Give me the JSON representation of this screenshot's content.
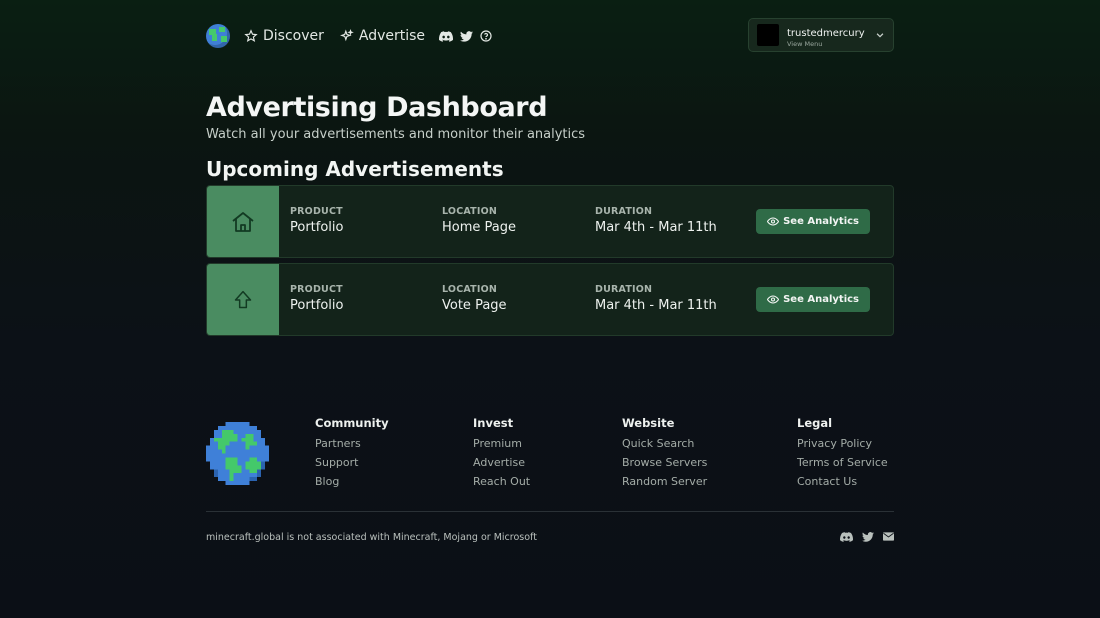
{
  "nav": {
    "discover_label": "Discover",
    "advertise_label": "Advertise",
    "socials": [
      "discord-icon",
      "twitter-icon",
      "help-icon"
    ],
    "user": {
      "name": "trustedmercury",
      "sub": "View Menu"
    }
  },
  "page": {
    "title": "Advertising Dashboard",
    "subtitle": "Watch all your advertisements and monitor their analytics",
    "section_title": "Upcoming Advertisements"
  },
  "ads": [
    {
      "icon": "home-icon",
      "product_label": "PRODUCT",
      "product": "Portfolio",
      "location_label": "LOCATION",
      "location": "Home Page",
      "duration_label": "DURATION",
      "duration": "Mar 4th - Mar 11th",
      "button": "See Analytics"
    },
    {
      "icon": "arrow-up-icon",
      "product_label": "PRODUCT",
      "product": "Portfolio",
      "location_label": "LOCATION",
      "location": "Vote Page",
      "duration_label": "DURATION",
      "duration": "Mar 4th - Mar 11th",
      "button": "See Analytics"
    }
  ],
  "footer": {
    "columns": [
      {
        "heading": "Community",
        "links": [
          "Partners",
          "Support",
          "Blog"
        ]
      },
      {
        "heading": "Invest",
        "links": [
          "Premium",
          "Advertise",
          "Reach Out"
        ]
      },
      {
        "heading": "Website",
        "links": [
          "Quick Search",
          "Browse Servers",
          "Random Server"
        ]
      },
      {
        "heading": "Legal",
        "links": [
          "Privacy Policy",
          "Terms of Service",
          "Contact Us"
        ]
      }
    ],
    "disclaimer": "minecraft.global is not associated with Minecraft, Mojang or Microsoft",
    "socials": [
      "discord-icon",
      "twitter-icon",
      "mail-icon"
    ]
  },
  "colors": {
    "accent": "#4a8c61",
    "button": "#2f6b47",
    "card": "#13231a"
  }
}
